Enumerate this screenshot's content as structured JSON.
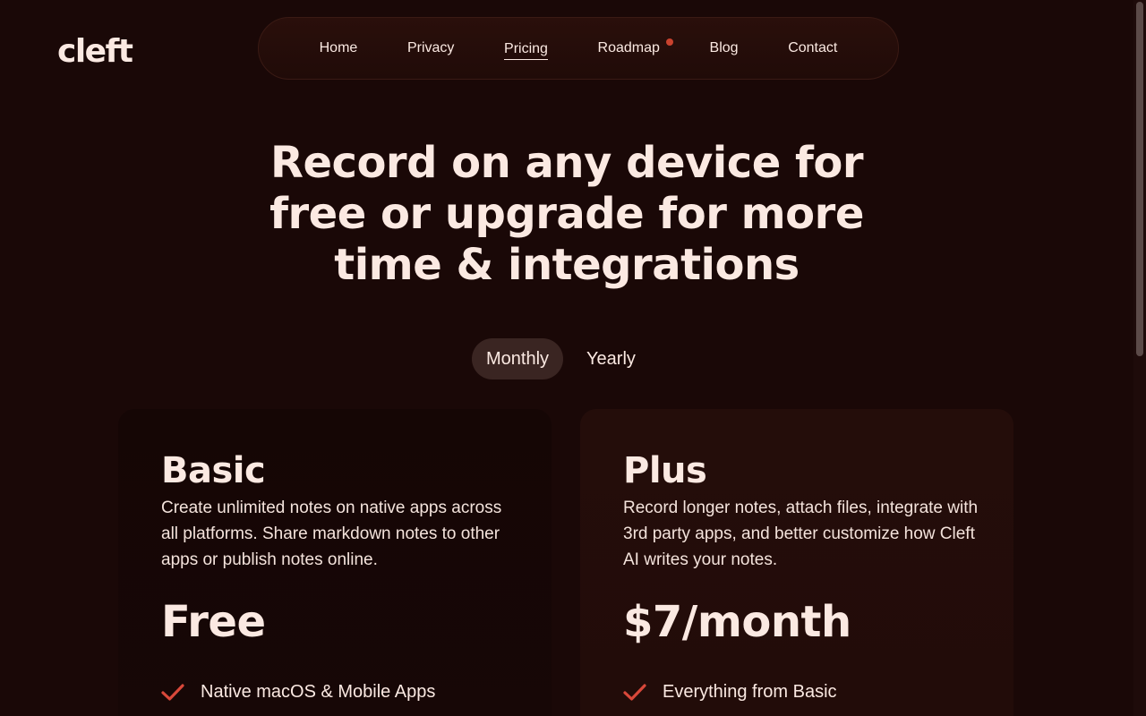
{
  "brand": {
    "logo_text": "cleft"
  },
  "nav": {
    "items": [
      {
        "label": "Home"
      },
      {
        "label": "Privacy"
      },
      {
        "label": "Pricing"
      },
      {
        "label": "Roadmap"
      },
      {
        "label": "Blog"
      },
      {
        "label": "Contact"
      }
    ],
    "active": "Pricing"
  },
  "hero": {
    "line1": "Record on any device for",
    "line2": "free or upgrade for more",
    "line3": "time & integrations"
  },
  "billing_toggle": {
    "monthly": "Monthly",
    "yearly": "Yearly",
    "selected": "Monthly"
  },
  "plans": [
    {
      "name": "Basic",
      "description": "Create unlimited notes on native apps across all platforms. Share markdown notes to other apps or publish notes online.",
      "price": "Free",
      "features": [
        "Native macOS & Mobile Apps"
      ]
    },
    {
      "name": "Plus",
      "description": "Record longer notes, attach files, integrate with 3rd party apps, and better customize how Cleft AI writes your notes.",
      "price": "$7/month",
      "features": [
        "Everything from Basic"
      ]
    }
  ],
  "colors": {
    "background": "#1a0807",
    "text": "#fbe9e2",
    "accent": "#d9483a",
    "nav_dot": "#c9422e"
  }
}
